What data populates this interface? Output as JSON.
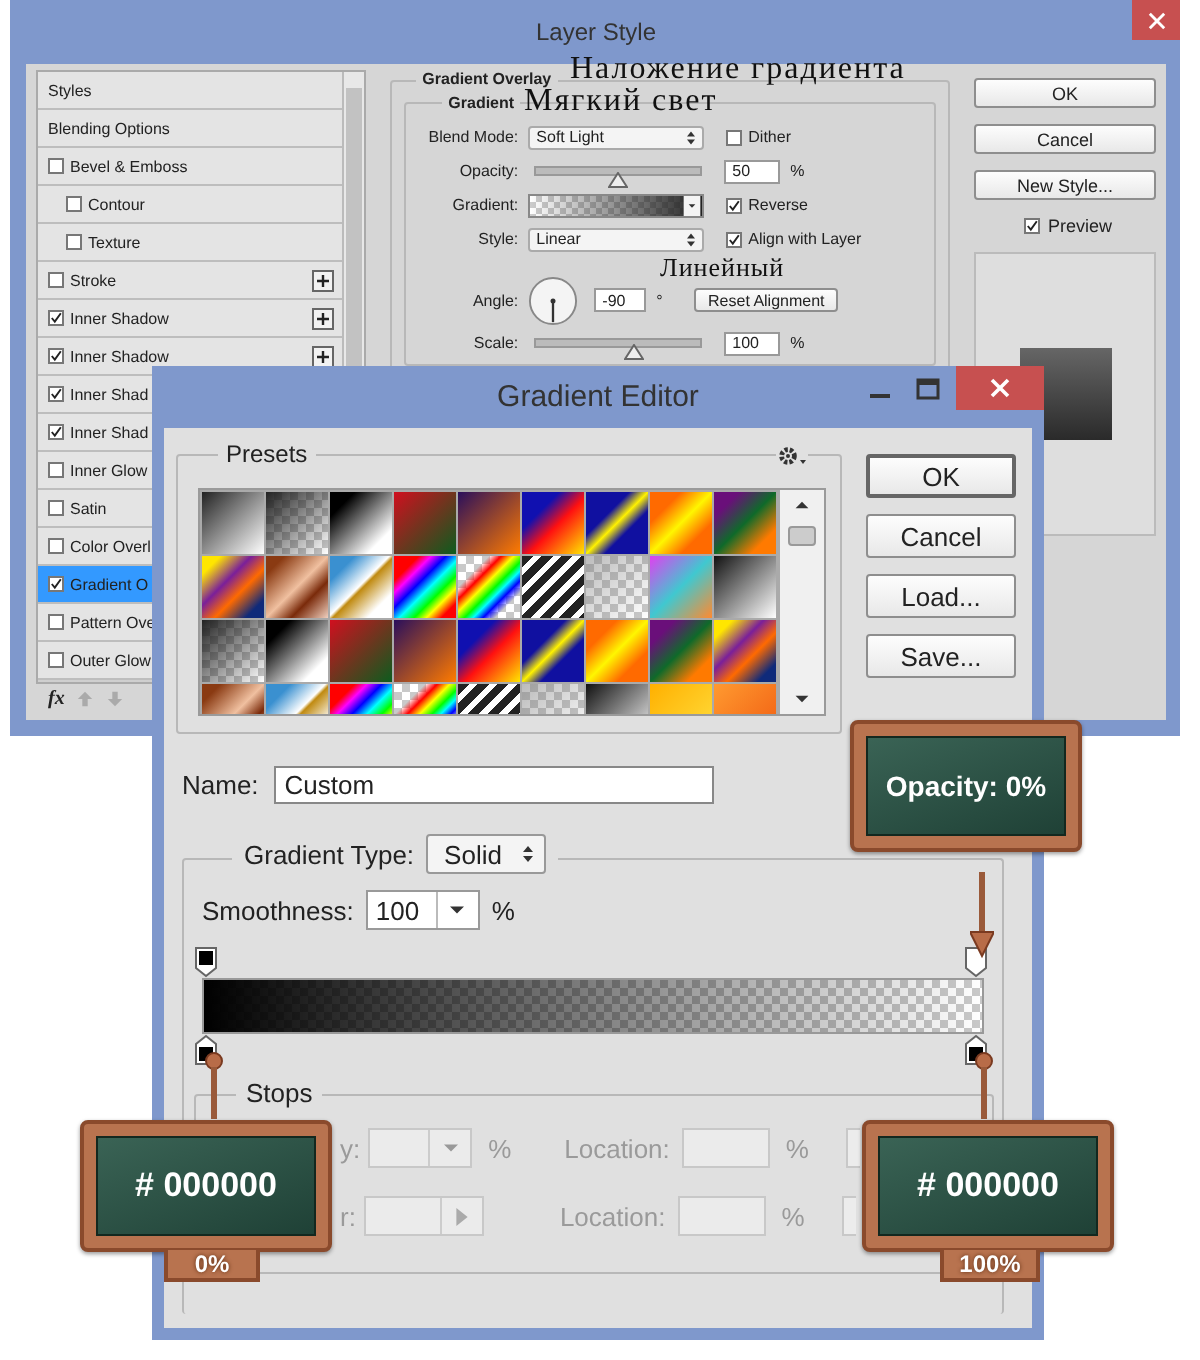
{
  "layer_style": {
    "title": "Layer Style",
    "effects": [
      {
        "label": "Styles",
        "kind": "heading",
        "selected": false
      },
      {
        "label": "Blending Options",
        "kind": "heading",
        "selected": false
      },
      {
        "label": "Bevel & Emboss",
        "kind": "effect",
        "checked": false,
        "selected": false,
        "add_button": false,
        "children": [
          {
            "label": "Contour",
            "kind": "effect",
            "checked": false,
            "selected": false,
            "add_button": false
          },
          {
            "label": "Texture",
            "kind": "effect",
            "checked": false,
            "selected": false,
            "add_button": false
          }
        ]
      },
      {
        "label": "Stroke",
        "kind": "effect",
        "checked": false,
        "selected": false,
        "add_button": true
      },
      {
        "label": "Inner Shadow",
        "kind": "effect",
        "checked": true,
        "selected": false,
        "add_button": true
      },
      {
        "label": "Inner Shadow",
        "kind": "effect",
        "checked": true,
        "selected": false,
        "add_button": true
      },
      {
        "label": "Inner Shad",
        "kind": "effect",
        "checked": true,
        "selected": false,
        "add_button": false
      },
      {
        "label": "Inner Shad",
        "kind": "effect",
        "checked": true,
        "selected": false,
        "add_button": false
      },
      {
        "label": "Inner Glow",
        "kind": "effect",
        "checked": false,
        "selected": false,
        "add_button": false
      },
      {
        "label": "Satin",
        "kind": "effect",
        "checked": false,
        "selected": false,
        "add_button": false
      },
      {
        "label": "Color Overl",
        "kind": "effect",
        "checked": false,
        "selected": false,
        "add_button": false
      },
      {
        "label": "Gradient O",
        "kind": "effect",
        "checked": true,
        "selected": true,
        "add_button": false
      },
      {
        "label": "Pattern Ove",
        "kind": "effect",
        "checked": false,
        "selected": false,
        "add_button": false
      },
      {
        "label": "Outer Glow",
        "kind": "effect",
        "checked": false,
        "selected": false,
        "add_button": false
      }
    ],
    "footer_icon": "fx",
    "section_title": "Gradient Overlay",
    "group_title": "Gradient",
    "fields": [
      {
        "kind": "select",
        "label": "Blend Mode:",
        "value": "Soft Light",
        "option": {
          "label": "Dither",
          "checked": false
        }
      },
      {
        "kind": "slider",
        "label": "Opacity:",
        "level": 0.5,
        "value": "50",
        "unit": "%"
      },
      {
        "kind": "gradient",
        "label": "Gradient:",
        "option": {
          "label": "Reverse",
          "checked": true
        }
      },
      {
        "kind": "select",
        "label": "Style:",
        "value": "Linear",
        "option": {
          "label": "Align with Layer",
          "checked": true
        }
      },
      {
        "kind": "angle",
        "label": "Angle:",
        "value": "-90",
        "unit": "°",
        "button": "Reset Alignment"
      },
      {
        "kind": "slider",
        "label": "Scale:",
        "level": 0.6,
        "value": "100",
        "unit": "%"
      }
    ],
    "buttons": [
      "OK",
      "Cancel",
      "New Style..."
    ],
    "preview": {
      "label": "Preview",
      "checked": true
    }
  },
  "gradient_editor": {
    "title": "Gradient Editor",
    "presets_title": "Presets",
    "buttons": [
      "OK",
      "Cancel",
      "Load...",
      "Save..."
    ],
    "name_label": "Name:",
    "name_value": "Custom",
    "type_label": "Gradient Type:",
    "type_value": "Solid",
    "smoothness_label": "Smoothness:",
    "smoothness_value": "100",
    "smoothness_unit": "%",
    "stops": {
      "title": "Stops",
      "disabled": true,
      "rows": [
        {
          "kind": "dropdown",
          "label": "y:",
          "unit": "%",
          "location_label": "Location:",
          "location_unit": "%"
        },
        {
          "kind": "color",
          "label": "r:",
          "location_label": "Location:",
          "location_unit": "%"
        }
      ]
    }
  },
  "annotations": {
    "captions": [
      "Наложение градиента",
      "Мягкий свет",
      "Линейный"
    ],
    "signs": [
      {
        "text": "Opacity: 0%"
      },
      {
        "text": "# 000000",
        "tab": "0%"
      },
      {
        "text": "# 000000",
        "tab": "100%"
      }
    ]
  }
}
